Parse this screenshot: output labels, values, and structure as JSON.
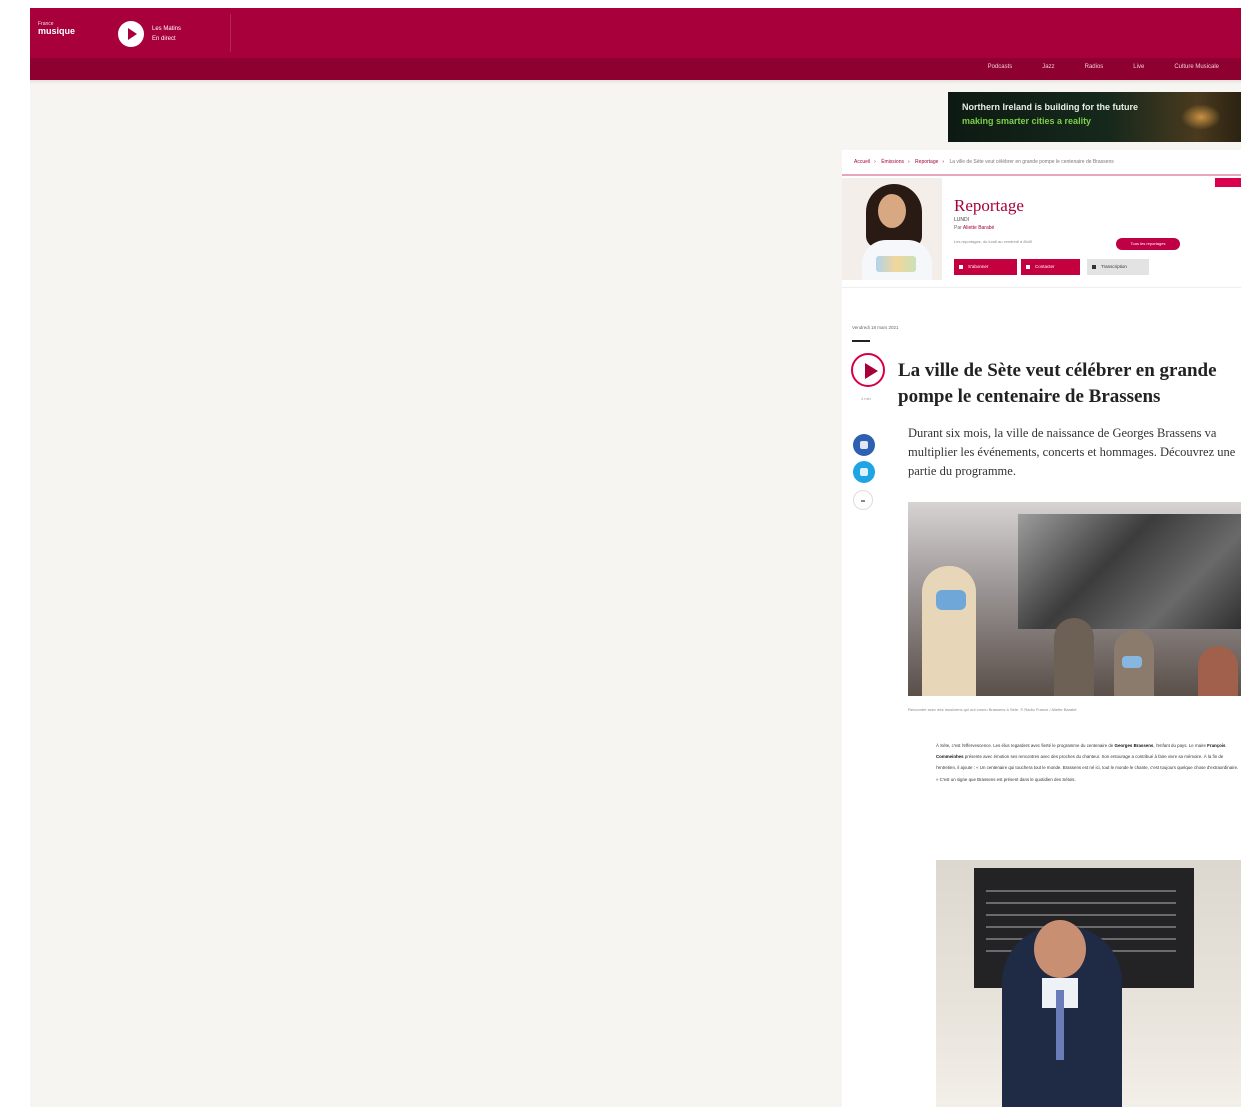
{
  "header": {
    "logo_line1": "France",
    "logo_line2": "musique",
    "live_line1": "Les Matins",
    "live_line2": "En direct",
    "nav": [
      "Podcasts",
      "Jazz",
      "Radios",
      "Live",
      "Culture Musicale"
    ]
  },
  "ad": {
    "line1": "Northern Ireland is building for the future",
    "line2": "making smarter cities a reality"
  },
  "breadcrumb": [
    "Accueil",
    "Émissions",
    "Reportage",
    "La ville de Sète veut célébrer en grande pompe le centenaire de Brassens"
  ],
  "show": {
    "title": "Reportage",
    "subtitle": "LUNDI",
    "by_prefix": "Par",
    "author": "Aliette Barabé",
    "schedule": "Les reportages, du lundi au vendredi à 8h40",
    "pill": "Tous les reportages",
    "buttons": [
      "S'abonner",
      "Contacter",
      "Transcription"
    ]
  },
  "article": {
    "date": "Vendredi 18 mars 2021",
    "duration": "4 min",
    "headline": "La ville de Sète veut célébrer en grande pompe le centenaire de Brassens",
    "lead": "Durant six mois, la ville de naissance de Georges Brassens va multiplier les événements, concerts et hommages. Découvrez une partie du programme.",
    "caption": "Rencontre avec des musiciens qui ont connu Brassens à Sète. © Radio France / Aliette Barabé",
    "body_a": "À Sète, c'est l'effervescence. Les élus regardent avec fierté le programme du centenaire de ",
    "body_b": "Georges Brassens",
    "body_c": ", l'enfant du pays. Le maire ",
    "body_d": "François Commeinhes",
    "body_e": " présente avec émotion ses rencontres avec des proches du chanteur. Son entourage a contribué à faire vivre sa mémoire. À la fin de l'entretien, il ajoute : « Un centenaire qui touchera tout le monde. Brassens est né ici, tout le monde le chante, c'est toujours quelque chose d'extraordinaire. » C'est un signe que Brassens est présent dans le quotidien des Sétois."
  },
  "colors": {
    "brand": "#a8003b",
    "brand_dark": "#8d0030",
    "accent": "#d4004a",
    "facebook": "#2d5fb2",
    "twitter": "#1ea4e4"
  }
}
